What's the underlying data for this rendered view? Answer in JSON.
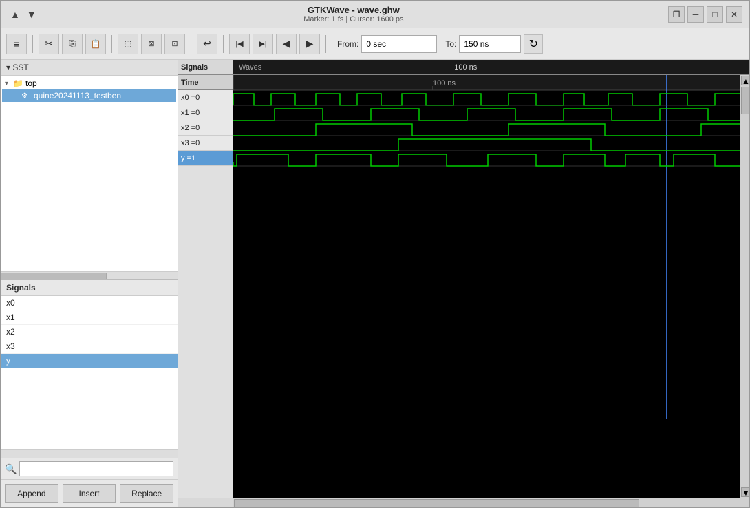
{
  "titlebar": {
    "title": "GTKWave - wave.ghw",
    "subtitle": "Marker: 1 fs  |  Cursor: 1600 ps",
    "arrow_up": "▲",
    "arrow_down": "▼",
    "btn_restore": "❐",
    "btn_minimize": "─",
    "btn_maximize": "□",
    "btn_close": "✕"
  },
  "toolbar": {
    "menu_icon": "≡",
    "cut_icon": "✂",
    "copy_icon": "⧉",
    "paste_icon": "⧉",
    "select_all": "⬜",
    "zoom_fit": "⊡",
    "zoom_select": "⊟",
    "undo": "↩",
    "go_start": "⏮",
    "go_end": "⏭",
    "prev": "◀",
    "next": "▶",
    "from_label": "From:",
    "from_value": "0 sec",
    "to_label": "To:",
    "to_value": "150 ns",
    "refresh_icon": "↻"
  },
  "sst": {
    "header": "▾ SST",
    "tree": [
      {
        "id": "top",
        "label": "top",
        "indent": 0,
        "expanded": true,
        "icon": "📁"
      },
      {
        "id": "testbench",
        "label": "quine20241113_testben",
        "indent": 1,
        "selected": true,
        "icon": "🔧"
      }
    ]
  },
  "signals_panel": {
    "header": "Signals",
    "items": [
      {
        "id": "x0",
        "label": "x0",
        "selected": false
      },
      {
        "id": "x1",
        "label": "x1",
        "selected": false
      },
      {
        "id": "x2",
        "label": "x2",
        "selected": false
      },
      {
        "id": "x3",
        "label": "x3",
        "selected": false
      },
      {
        "id": "y",
        "label": "y",
        "selected": true
      }
    ],
    "search_placeholder": ""
  },
  "buttons": {
    "append": "Append",
    "insert": "Insert",
    "replace": "Replace"
  },
  "wave_panel": {
    "ruler_label": "100 ns",
    "signals": [
      {
        "id": "time",
        "label": "Time",
        "value": "",
        "is_header": true
      },
      {
        "id": "x0",
        "label": "x0 =0",
        "value": "0"
      },
      {
        "id": "x1",
        "label": "x1 =0",
        "value": "0"
      },
      {
        "id": "x2",
        "label": "x2 =0",
        "value": "0"
      },
      {
        "id": "x3",
        "label": "x3 =0",
        "value": "0"
      },
      {
        "id": "y",
        "label": "y =1",
        "value": "1",
        "selected": true
      }
    ]
  }
}
